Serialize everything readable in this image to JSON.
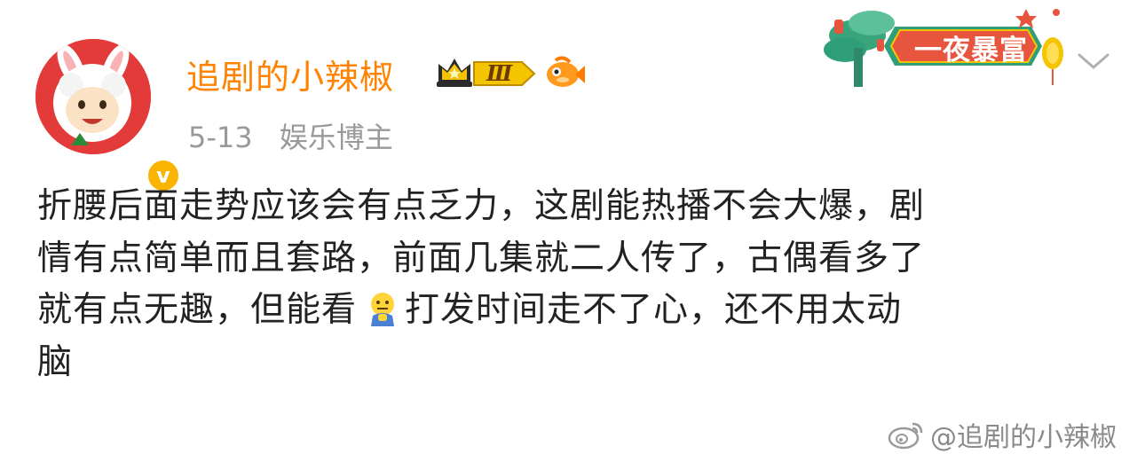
{
  "post": {
    "author": {
      "name": "追剧的小辣椒",
      "verified_mark": "v",
      "level_badge": "Ⅲ"
    },
    "date": "5-13",
    "author_category": "娱乐博主",
    "decoration_label": "一夜暴富",
    "body_lines": [
      "折腰后面走势应该会有点乏力，这剧能热播不会大爆，剧",
      "情有点简单而且套路，前面几集就二人传了，古偶看多了",
      "就有点无趣，但能看",
      "打发时间走不了心，还不用太动",
      "脑"
    ],
    "watermark": "@追剧的小辣椒"
  },
  "icons": {
    "avatar": "cartoon-sheep-avatar",
    "verified": "verified-v-icon",
    "crown": "crown-icon",
    "fish": "fish-icon",
    "emoji": "thinking-emoji-icon",
    "more": "chevron-down-icon",
    "weibo": "weibo-logo-icon"
  },
  "colors": {
    "name": "#ff8200",
    "meta": "#999999",
    "text": "#222222",
    "verified": "#f8b400",
    "avatar_bg": "#e33a3a",
    "decor_green": "#2f9f7a"
  }
}
